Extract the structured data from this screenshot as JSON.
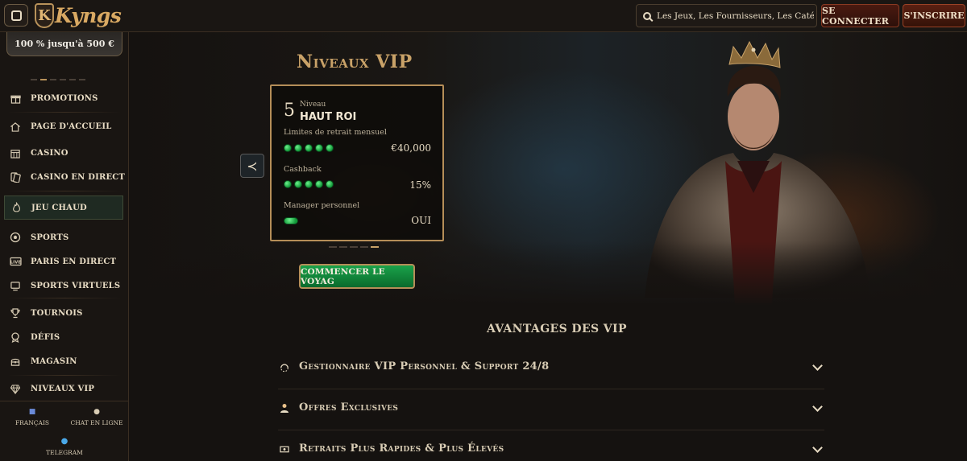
{
  "header": {
    "logo_mark": "K",
    "logo_text": "Kyngs",
    "search_placeholder": "Les Jeux, Les Fournisseurs, Les Catégories",
    "login_label": "SE CONNECTER",
    "signup_label": "S'INSCRIRE"
  },
  "sidebar": {
    "promo_banner": "100 % jusqu'à 500 €",
    "items": [
      {
        "label": "PROMOTIONS",
        "icon": "gift-icon"
      },
      {
        "label": "PAGE D'ACCUEIL",
        "icon": "home-icon"
      },
      {
        "label": "CASINO",
        "icon": "casino-icon"
      },
      {
        "label": "CASINO EN DIRECT",
        "icon": "cards-icon"
      },
      {
        "label": "JEU CHAUD",
        "icon": "flame-icon"
      },
      {
        "label": "SPORTS",
        "icon": "soccer-ball-icon"
      },
      {
        "label": "PARIS EN DIRECT",
        "icon": "live-icon"
      },
      {
        "label": "SPORTS VIRTUELS",
        "icon": "monitor-icon"
      },
      {
        "label": "TOURNOIS",
        "icon": "trophy-icon"
      },
      {
        "label": "DÉFIS",
        "icon": "medal-icon"
      },
      {
        "label": "MAGASIN",
        "icon": "treasure-chest-icon"
      },
      {
        "label": "NIVEAUX VIP",
        "icon": "diamond-icon"
      }
    ],
    "footer": {
      "language": "FRANÇAIS",
      "chat": "CHAT EN LIGNE",
      "telegram": "TELEGRAM"
    }
  },
  "vip": {
    "title": "Niveaux VIP",
    "card": {
      "level_number": "5",
      "level_label": "Niveau",
      "level_name": "HAUT ROI",
      "withdraw_label": "Limites de retrait mensuel",
      "withdraw_value": "€40,000",
      "withdraw_pips": 5,
      "cashback_label": "Cashback",
      "cashback_value": "15%",
      "cashback_pips": 5,
      "manager_label": "Manager personnel",
      "manager_value": "OUI"
    },
    "slides_total": 5,
    "slide_active": 5,
    "cta_label": "COMMENCER LE VOYAG"
  },
  "benefits": {
    "title": "AVANTAGES DES VIP",
    "items": [
      {
        "label": "Gestionnaire VIP Personnel & Support 24/8",
        "icon": "support-icon"
      },
      {
        "label": "Offres Exclusives",
        "icon": "person-icon"
      },
      {
        "label": "Retraits Plus Rapides & Plus Élevés",
        "icon": "cash-icon"
      }
    ]
  },
  "colors": {
    "accent_gold": "#c9a268",
    "cta_green": "#1aa24a",
    "background": "#151210"
  }
}
